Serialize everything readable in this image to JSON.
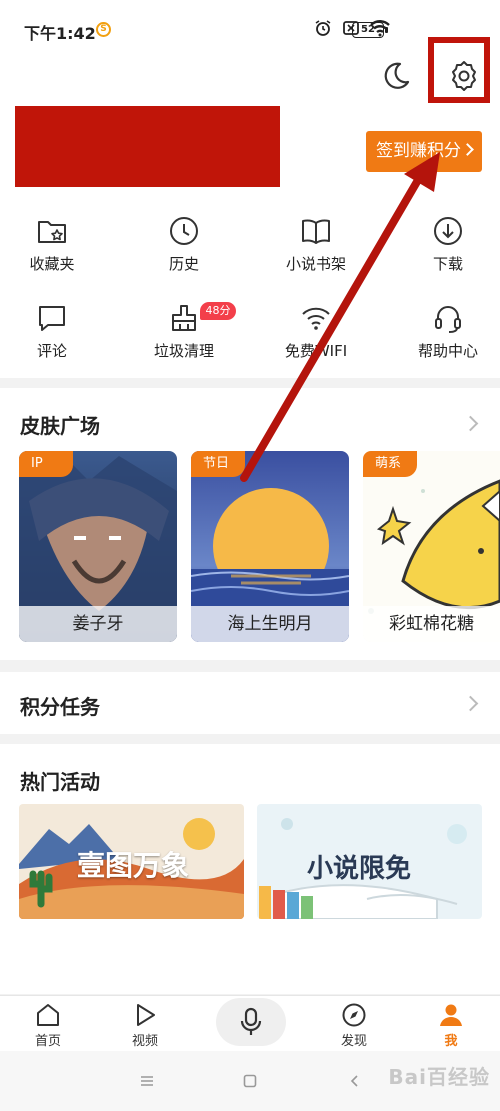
{
  "status_bar": {
    "time": "下午1:42",
    "app_badge": "S",
    "battery": "52"
  },
  "header": {
    "signin_button": "签到赚积分"
  },
  "shortcuts": [
    {
      "label": "收藏夹",
      "icon": "folder-star-icon"
    },
    {
      "label": "历史",
      "icon": "clock-icon"
    },
    {
      "label": "小说书架",
      "icon": "book-icon"
    },
    {
      "label": "下载",
      "icon": "download-icon"
    },
    {
      "label": "评论",
      "icon": "comment-icon"
    },
    {
      "label": "垃圾清理",
      "icon": "broom-icon",
      "badge": "48分"
    },
    {
      "label": "免费WIFI",
      "icon": "wifi-icon"
    },
    {
      "label": "帮助中心",
      "icon": "headset-icon"
    }
  ],
  "skin_section": {
    "title": "皮肤广场",
    "cards": [
      {
        "tag": "IP",
        "name": "姜子牙"
      },
      {
        "tag": "节日",
        "name": "海上生明月"
      },
      {
        "tag": "萌系",
        "name": "彩虹棉花糖"
      }
    ]
  },
  "points_section": {
    "title": "积分任务"
  },
  "activity_section": {
    "title": "热门活动",
    "promos": [
      {
        "text": "壹图万象"
      },
      {
        "text": "小说限免"
      }
    ]
  },
  "bottom_nav": [
    {
      "label": "首页",
      "icon": "home-icon"
    },
    {
      "label": "视频",
      "icon": "play-icon"
    },
    {
      "label": "",
      "icon": "mic-icon"
    },
    {
      "label": "发现",
      "icon": "compass-icon"
    },
    {
      "label": "我",
      "icon": "person-icon",
      "active": true
    }
  ],
  "watermark": "Bai百经验",
  "colors": {
    "accent": "#f07a14",
    "highlight_red": "#c0140a",
    "badge_red": "#f33f4a"
  }
}
